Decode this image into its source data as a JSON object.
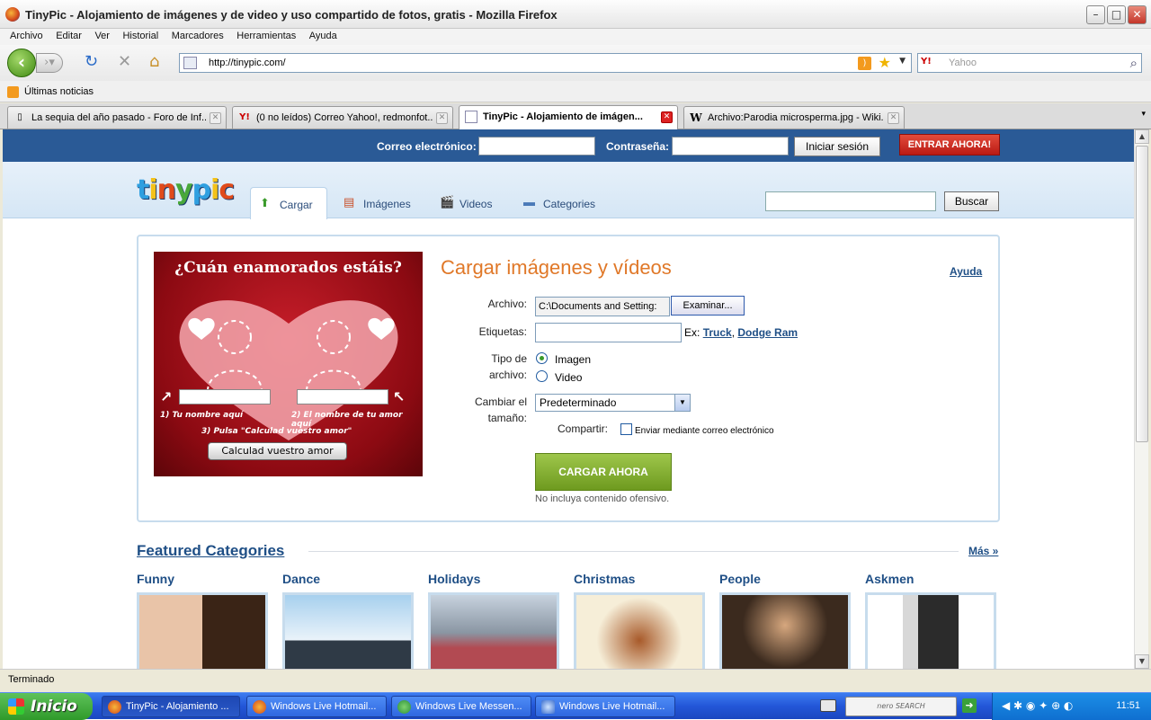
{
  "window": {
    "title": "TinyPic - Alojamiento de imágenes y de video y uso compartido de fotos, gratis - Mozilla Firefox"
  },
  "menu": [
    "Archivo",
    "Editar",
    "Ver",
    "Historial",
    "Marcadores",
    "Herramientas",
    "Ayuda"
  ],
  "nav": {
    "url": "http://tinypic.com/",
    "search_placeholder": "Yahoo",
    "search_engine": "Y!"
  },
  "bookmarks": {
    "item": "Últimas noticias"
  },
  "tabs": [
    {
      "label": "La sequia del año pasado - Foro de Inf...",
      "icon": "page-icon"
    },
    {
      "label": "(0 no leídos) Correo Yahoo!, redmonfot...",
      "icon": "yahoo-icon"
    },
    {
      "label": "TinyPic - Alojamiento de imágen...",
      "icon": "tinypic-icon"
    },
    {
      "label": "Archivo:Parodia microsperma.jpg - Wiki...",
      "icon": "wikipedia-icon"
    }
  ],
  "login": {
    "email_label": "Correo electrónico:",
    "password_label": "Contraseña:",
    "signin": "Iniciar sesión",
    "enter": "ENTRAR AHORA!"
  },
  "site": {
    "logo": "tinypic",
    "logo_colors": [
      "#2f9fe0",
      "#f4c21a",
      "#e04a1a",
      "#49a83a",
      "#2f9fe0",
      "#f4c21a",
      "#e04a1a"
    ],
    "tabs": [
      "Cargar",
      "Imágenes",
      "Videos",
      "Categories"
    ],
    "search_button": "Buscar"
  },
  "ad": {
    "title": "¿Cuán enamorados estáis?",
    "step1": "1) Tu nombre aquí",
    "step2": "2) El nombre de tu amor aquí",
    "step3": "3) Pulsa \"Calculad vuestro amor\"",
    "button": "Calculad vuestro amor"
  },
  "upload": {
    "title": "Cargar imágenes y vídeos",
    "help": "Ayuda",
    "file_label": "Archivo:",
    "file_value": "C:\\Documents and Setting:",
    "browse": "Examinar...",
    "tags_label": "Etiquetas:",
    "tags_example_prefix": "Ex:",
    "tags_example1": "Truck",
    "tags_example_sep": ",",
    "tags_example2": "Dodge Ram",
    "type_label_1": "Tipo de",
    "type_label_2": "archivo:",
    "type_image": "Imagen",
    "type_video": "Video",
    "size_label_1": "Cambiar el",
    "size_label_2": "tamaño:",
    "size_value": "Predeterminado",
    "share_label": "Compartir:",
    "share_option": "Enviar mediante correo electrónico",
    "submit": "CARGAR AHORA",
    "note": "No incluya contenido ofensivo."
  },
  "featured": {
    "title": "Featured Categories",
    "more": "Más »",
    "categories": [
      "Funny",
      "Dance",
      "Holidays",
      "Christmas",
      "People",
      "Askmen"
    ]
  },
  "status": "Terminado",
  "taskbar": {
    "start": "Inicio",
    "tasks": [
      "TinyPic - Alojamiento ...",
      "Windows Live Hotmail...",
      "Windows Live Messen...",
      "Windows Live Hotmail..."
    ],
    "nero": "nero SEARCH",
    "clock": "11:51"
  }
}
